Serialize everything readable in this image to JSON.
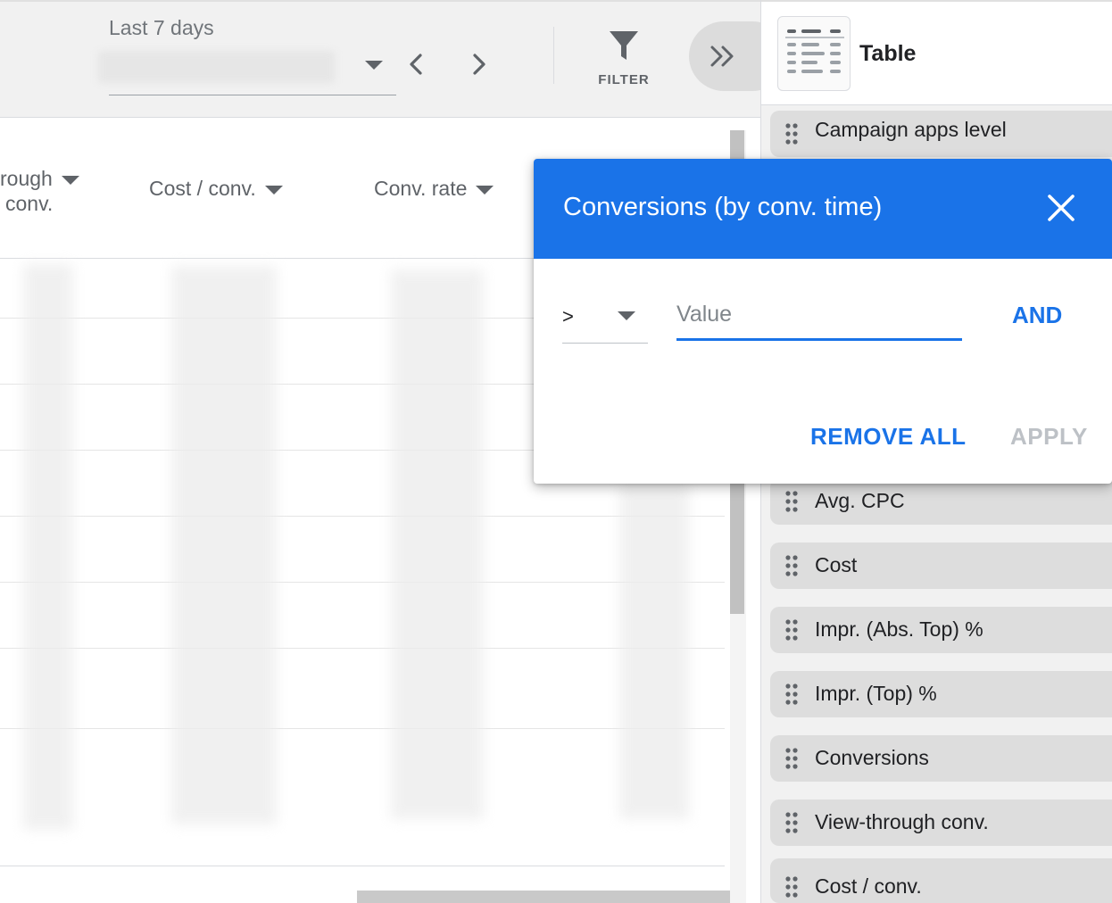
{
  "toolbar": {
    "date_range_label": "Last 7 days",
    "filter_label": "FILTER"
  },
  "table": {
    "headers": [
      {
        "line1": "rough",
        "line2": "conv."
      },
      {
        "label": "Cost / conv."
      },
      {
        "label": "Conv. rate"
      }
    ]
  },
  "right_panel": {
    "title": "Table",
    "columns": [
      "Campaign apps level",
      "Avg. CPC",
      "Cost",
      "Impr. (Abs. Top) %",
      "Impr. (Top) %",
      "Conversions",
      "View-through conv.",
      "Cost / conv."
    ]
  },
  "filter_popup": {
    "title": "Conversions (by conv. time)",
    "operator": ">",
    "value_placeholder": "Value",
    "and_label": "AND",
    "remove_all_label": "REMOVE ALL",
    "apply_label": "APPLY",
    "header_color": "#1a73e8"
  },
  "icons": [
    "chevron-down-icon",
    "chevron-left-icon",
    "chevron-right-icon",
    "filter-funnel-icon",
    "double-chevron-right-icon",
    "table-layout-icon",
    "drag-handle-icon",
    "close-icon"
  ]
}
